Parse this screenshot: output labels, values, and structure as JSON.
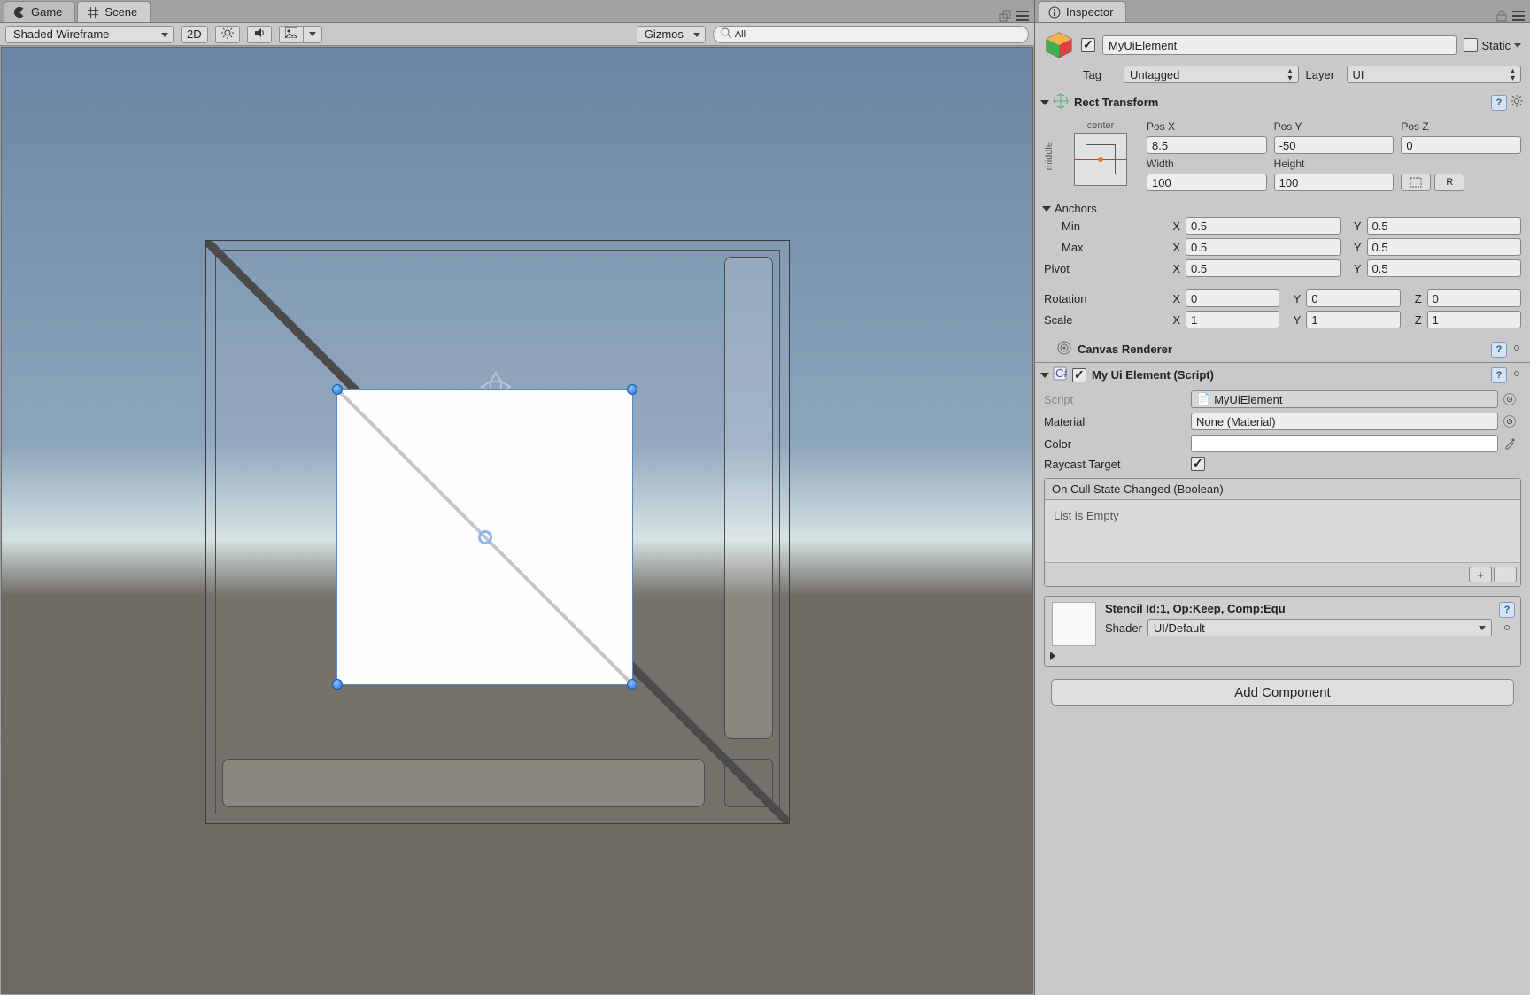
{
  "tabs": {
    "game": "Game",
    "scene": "Scene"
  },
  "toolbar": {
    "shading": "Shaded Wireframe",
    "twod": "2D",
    "gizmos": "Gizmos",
    "search_prefix": "All"
  },
  "inspector": {
    "title": "Inspector",
    "object_name": "MyUiElement",
    "static": "Static",
    "tag_label": "Tag",
    "tag_value": "Untagged",
    "layer_label": "Layer",
    "layer_value": "UI"
  },
  "rect": {
    "title": "Rect Transform",
    "preset_h": "center",
    "preset_v": "middle",
    "posx_l": "Pos X",
    "posy_l": "Pos Y",
    "posz_l": "Pos Z",
    "posx": "8.5",
    "posy": "-50",
    "posz": "0",
    "w_l": "Width",
    "h_l": "Height",
    "w": "100",
    "h": "100",
    "anchors": "Anchors",
    "min": "Min",
    "max": "Max",
    "pivot": "Pivot",
    "min_x": "0.5",
    "min_y": "0.5",
    "max_x": "0.5",
    "max_y": "0.5",
    "piv_x": "0.5",
    "piv_y": "0.5",
    "rotation": "Rotation",
    "rx": "0",
    "ry": "0",
    "rz": "0",
    "scale": "Scale",
    "sx": "1",
    "sy": "1",
    "sz": "1",
    "blueprint": "⠿",
    "raw": "R"
  },
  "canvasr": {
    "title": "Canvas Renderer"
  },
  "script": {
    "title": "My Ui Element (Script)",
    "script_l": "Script",
    "script_v": "MyUiElement",
    "material_l": "Material",
    "material_v": "None (Material)",
    "color_l": "Color",
    "raycast_l": "Raycast Target",
    "event_head": "On Cull State Changed (Boolean)",
    "event_empty": "List is Empty"
  },
  "material": {
    "title": "Stencil Id:1, Op:Keep, Comp:Equ",
    "shader_l": "Shader",
    "shader_v": "UI/Default"
  },
  "add_component": "Add Component",
  "axes": {
    "x": "X",
    "y": "Y",
    "z": "Z"
  }
}
